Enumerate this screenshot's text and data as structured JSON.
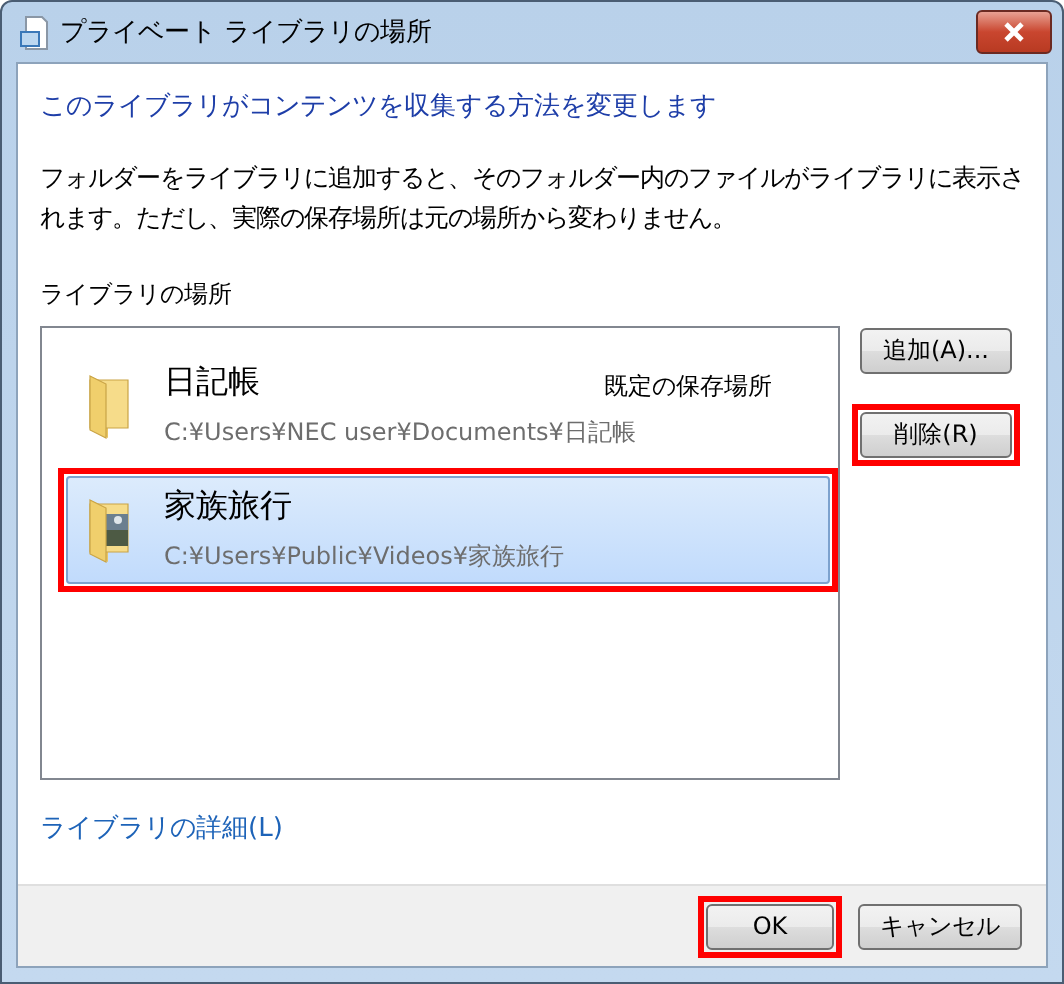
{
  "window": {
    "title": "プライベート ライブラリの場所"
  },
  "heading": "このライブラリがコンテンツを収集する方法を変更します",
  "description": "フォルダーをライブラリに追加すると、そのフォルダー内のファイルがライブラリに表示されます。ただし、実際の保存場所は元の場所から変わりません。",
  "locations": {
    "label": "ライブラリの場所",
    "items": [
      {
        "kind": "folder",
        "name": "日記帳",
        "note": "既定の保存場所",
        "path": "C:¥Users¥NEC user¥Documents¥日記帳",
        "selected": false,
        "highlighted": false
      },
      {
        "kind": "picture-folder",
        "name": "家族旅行",
        "path": "C:¥Users¥Public¥Videos¥家族旅行",
        "selected": true,
        "highlighted": true
      }
    ]
  },
  "side_buttons": [
    {
      "label": "追加(A)...",
      "highlighted": false
    },
    {
      "label": "削除(R)",
      "highlighted": true
    }
  ],
  "details_link": "ライブラリの詳細(L)",
  "buttons": [
    {
      "label": "OK",
      "highlighted": true
    },
    {
      "label": "キャンセル",
      "highlighted": false
    }
  ]
}
